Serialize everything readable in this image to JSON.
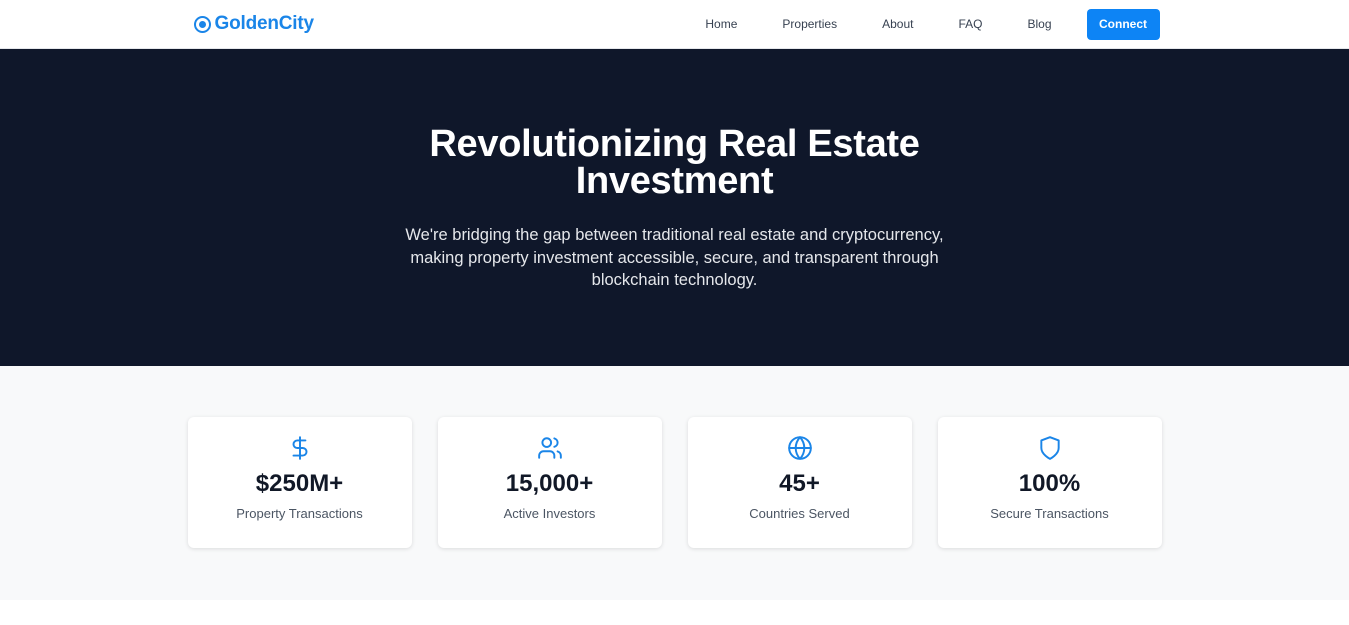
{
  "nav": {
    "brand": "GoldenCity",
    "links": [
      "Home",
      "Properties",
      "About",
      "FAQ",
      "Blog"
    ],
    "connect_label": "Connect"
  },
  "hero": {
    "title": "Revolutionizing Real Estate Investment",
    "subtitle": "We're bridging the gap between traditional real estate and cryptocurrency, making property investment accessible, secure, and transparent through blockchain technology."
  },
  "stats": [
    {
      "icon": "dollar-icon",
      "value": "$250M+",
      "label": "Property Transactions"
    },
    {
      "icon": "users-icon",
      "value": "15,000+",
      "label": "Active Investors"
    },
    {
      "icon": "globe-icon",
      "value": "45+",
      "label": "Countries Served"
    },
    {
      "icon": "shield-icon",
      "value": "100%",
      "label": "Secure Transactions"
    }
  ],
  "colors": {
    "brand": "#1a85e8",
    "button": "#0d84f5",
    "hero_bg": "#0f172a",
    "stats_bg": "#f8f9fa"
  }
}
